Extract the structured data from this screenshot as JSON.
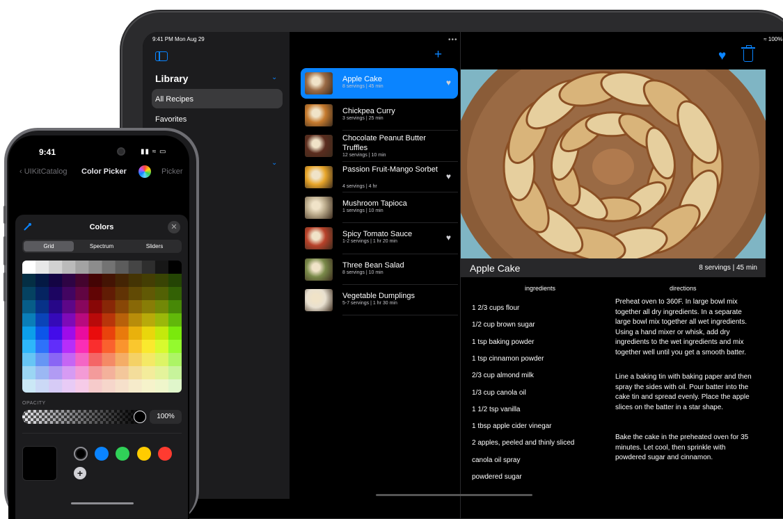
{
  "ipad": {
    "status_time": "9:41 PM  Mon Aug 29",
    "status_right": "100%",
    "sidebar": {
      "section_title": "Library",
      "items": [
        {
          "label": "All Recipes",
          "selected": true
        },
        {
          "label": "Favorites",
          "selected": false
        }
      ]
    },
    "recipes": [
      {
        "name": "Apple Cake",
        "meta": "8 servings | 45 min",
        "favorite": true,
        "selected": true
      },
      {
        "name": "Chickpea Curry",
        "meta": "3 servings | 25 min",
        "favorite": false,
        "selected": false
      },
      {
        "name": "Chocolate Peanut Butter Truffles",
        "meta": "12 servings | 10 min",
        "favorite": false,
        "selected": false
      },
      {
        "name": "Passion Fruit-Mango Sorbet",
        "meta": "4 servings | 4 hr",
        "favorite": true,
        "selected": false
      },
      {
        "name": "Mushroom Tapioca",
        "meta": "1 servings | 10 min",
        "favorite": false,
        "selected": false
      },
      {
        "name": "Spicy Tomato Sauce",
        "meta": "1-2 servings | 1 hr 20 min",
        "favorite": true,
        "selected": false
      },
      {
        "name": "Three Bean Salad",
        "meta": "8 servings | 10 min",
        "favorite": false,
        "selected": false
      },
      {
        "name": "Vegetable Dumplings",
        "meta": "5-7 servings | 1 hr 30 min",
        "favorite": false,
        "selected": false
      }
    ],
    "detail": {
      "title": "Apple Cake",
      "meta": "8 servings | 45 min",
      "ingredients_header": "ingredients",
      "directions_header": "directions",
      "ingredients": [
        "1 2/3 cups flour",
        "1/2 cup brown sugar",
        "1 tsp baking powder",
        "1 tsp cinnamon powder",
        "2/3 cup almond milk",
        "1/3 cup canola oil",
        "1 1/2 tsp vanilla",
        "1 tbsp apple cider vinegar",
        "2 apples, peeled and thinly sliced",
        "canola oil spray",
        "powdered sugar"
      ],
      "directions": [
        "Preheat oven to 360F. In large bowl mix together all dry ingredients. In a separate large bowl mix together all wet ingredients. Using a hand mixer or whisk, add dry ingredients to the wet ingredients and mix together well until you get a smooth batter.",
        "Line a baking tin with baking paper and then spray the sides with oil. Pour batter into the cake tin and spread evenly. Place the apple slices on the batter in a star shape.",
        "Bake the cake in the preheated oven for 35 minutes. Let cool, then sprinkle with powdered sugar and cinnamon."
      ]
    },
    "accent_color": "#0a84ff"
  },
  "iphone": {
    "status_time": "9:41",
    "nav": {
      "back_label": "UIKitCatalog",
      "title": "Color Picker",
      "right_label": "Picker"
    },
    "sheet": {
      "title": "Colors",
      "segments": [
        {
          "label": "Grid",
          "selected": true
        },
        {
          "label": "Spectrum",
          "selected": false
        },
        {
          "label": "Sliders",
          "selected": false
        }
      ],
      "opacity_label": "OPACITY",
      "opacity_value": "100%",
      "opacity_level": 1.0,
      "selected_color": "#000000",
      "saved_colors": [
        "#000000",
        "#0a84ff",
        "#30d158",
        "#ffcc00",
        "#ff3b30"
      ]
    }
  }
}
